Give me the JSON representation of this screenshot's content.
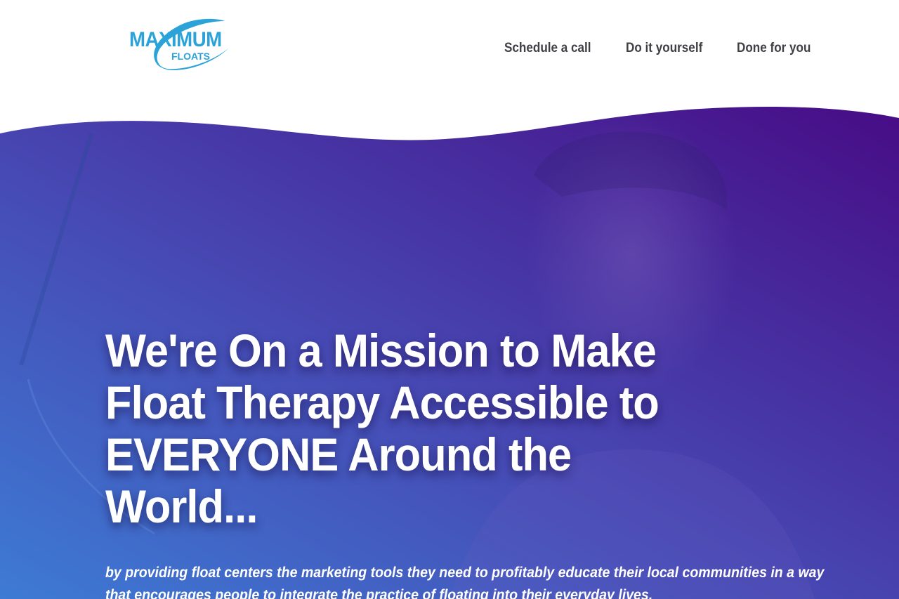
{
  "logo": {
    "top_word": "MAXIMUM",
    "bottom_word": "FLOATS",
    "color": "#2ba3d8"
  },
  "nav": {
    "items": [
      {
        "label": "Schedule a call"
      },
      {
        "label": "Do it yourself"
      },
      {
        "label": "Done for you"
      }
    ]
  },
  "hero": {
    "title": "We're On a Mission to Make Float Therapy Accessible to EVERYONE Around the World...",
    "subtitle": "by providing float centers the marketing tools they need to profitably educate their local communities in a way that encourages people to integrate the practice of floating into their everyday lives.",
    "gradient_start": "#3a6fd0",
    "gradient_mid": "#4a3fb0",
    "gradient_end": "#4a0f8a"
  }
}
